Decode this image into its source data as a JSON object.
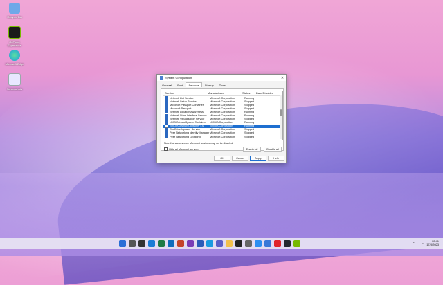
{
  "desktop": {
    "icons": [
      {
        "label": "Recycle Bin",
        "icon": "recycle-bin-icon",
        "color": "#6fa8e8"
      },
      {
        "label": "GeForce Experience",
        "icon": "nvidia-icon",
        "color": "#76b900"
      },
      {
        "label": "Microsoft Edge",
        "icon": "edge-icon",
        "color": "#1a9be0"
      },
      {
        "label": "Screenshots",
        "icon": "folder-icon",
        "color": "#e8e8ff"
      }
    ]
  },
  "dialog": {
    "title": "System Configuration",
    "close": "✕",
    "tabs": [
      "General",
      "Boot",
      "Services",
      "Startup",
      "Tools"
    ],
    "active_tab": "Services",
    "columns": {
      "service": "Service",
      "manufacturer": "Manufacturer",
      "status": "Status",
      "date_disabled": "Date Disabled"
    },
    "rows": [
      {
        "service": "Network List Service",
        "manufacturer": "Microsoft Corporation",
        "status": "Running",
        "checked": true
      },
      {
        "service": "Network Setup Service",
        "manufacturer": "Microsoft Corporation",
        "status": "Stopped",
        "checked": true
      },
      {
        "service": "Microsoft Passport Container",
        "manufacturer": "Microsoft Corporation",
        "status": "Stopped",
        "checked": true
      },
      {
        "service": "Microsoft Passport",
        "manufacturer": "Microsoft Corporation",
        "status": "Stopped",
        "checked": true
      },
      {
        "service": "Network Location Awareness",
        "manufacturer": "Microsoft Corporation",
        "status": "Running",
        "checked": true
      },
      {
        "service": "Network Store Interface Service",
        "manufacturer": "Microsoft Corporation",
        "status": "Running",
        "checked": true
      },
      {
        "service": "Network Virtualization Service",
        "manufacturer": "Microsoft Corporation",
        "status": "Stopped",
        "checked": true
      },
      {
        "service": "NVIDIA LocalSystem Container",
        "manufacturer": "NVIDIA Corporation",
        "status": "Running",
        "checked": true
      },
      {
        "service": "NVIDIA Display Container LS",
        "manufacturer": "NVIDIA Corporation",
        "status": "Running",
        "checked": false,
        "selected": true
      },
      {
        "service": "OneDrive Updater Service",
        "manufacturer": "Microsoft Corporation",
        "status": "Stopped",
        "checked": true
      },
      {
        "service": "Peer Networking Identity Manager",
        "manufacturer": "Microsoft Corporation",
        "status": "Stopped",
        "checked": true
      },
      {
        "service": "Peer Networking Grouping",
        "manufacturer": "Microsoft Corporation",
        "status": "Stopped",
        "checked": true
      }
    ],
    "note": "Note that some secure Microsoft services may not be disabled.",
    "enable_all": "Enable all",
    "disable_all": "Disable all",
    "hide_ms": "Hide all Microsoft services",
    "ok": "OK",
    "cancel": "Cancel",
    "apply": "Apply",
    "help": "Help"
  },
  "taskbar": {
    "icons": [
      {
        "name": "start-icon",
        "color": "#2a6fd6"
      },
      {
        "name": "search-icon",
        "color": "#555555"
      },
      {
        "name": "task-view-icon",
        "color": "#333333"
      },
      {
        "name": "onedrive-icon",
        "color": "#1c7cd5"
      },
      {
        "name": "excel-icon",
        "color": "#1f7a45"
      },
      {
        "name": "outlook-icon",
        "color": "#0f6cbd"
      },
      {
        "name": "powerpoint-icon",
        "color": "#c4452b"
      },
      {
        "name": "onenote-icon",
        "color": "#7b3db6"
      },
      {
        "name": "word-icon",
        "color": "#2b5cb8"
      },
      {
        "name": "edge-icon",
        "color": "#1a9be0"
      },
      {
        "name": "teams-icon",
        "color": "#5b5fc7"
      },
      {
        "name": "file-explorer-icon",
        "color": "#f2c14e"
      },
      {
        "name": "terminal-icon",
        "color": "#222222"
      },
      {
        "name": "settings-icon",
        "color": "#666666"
      },
      {
        "name": "photos-icon",
        "color": "#2d8ef0"
      },
      {
        "name": "store-icon",
        "color": "#3a78d8"
      },
      {
        "name": "opera-icon",
        "color": "#e0242b"
      },
      {
        "name": "github-icon",
        "color": "#24292f"
      },
      {
        "name": "nvidia-icon",
        "color": "#76b900"
      }
    ],
    "time": "02:41",
    "date": "17/8/2023"
  }
}
